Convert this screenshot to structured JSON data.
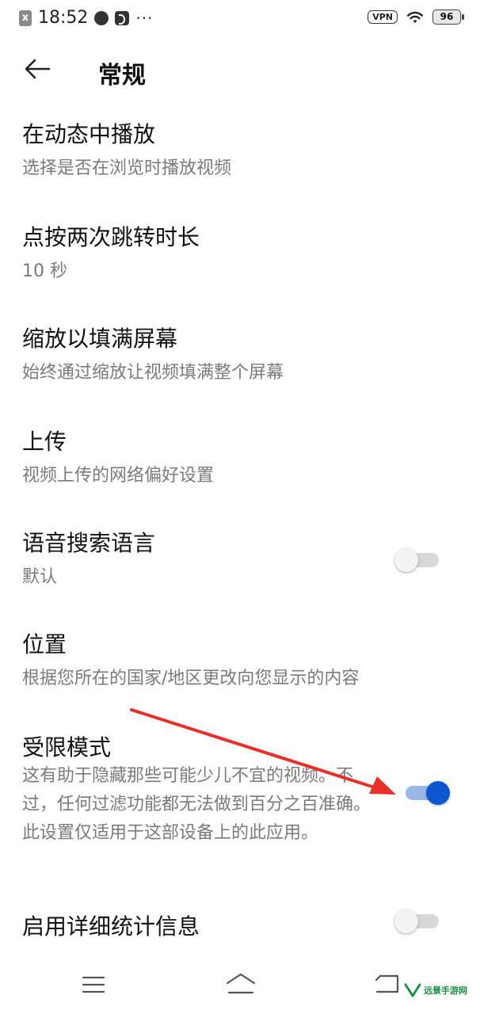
{
  "status_bar": {
    "time": "18:52",
    "more": "···",
    "vpn": "VPN",
    "battery": "96"
  },
  "header": {
    "title": "常规"
  },
  "settings": [
    {
      "title": "在动态中播放",
      "desc": "选择是否在浏览时播放视频"
    },
    {
      "title": "点按两次跳转时长",
      "desc": "10 秒"
    },
    {
      "title": "缩放以填满屏幕",
      "desc": "始终通过缩放让视频填满整个屏幕",
      "toggle": false
    },
    {
      "title": "上传",
      "desc": "视频上传的网络偏好设置"
    },
    {
      "title": "语音搜索语言",
      "desc": "默认"
    },
    {
      "title": "位置",
      "desc": "根据您所在的国家/地区更改向您显示的内容"
    },
    {
      "title": "受限模式",
      "desc": "这有助于隐藏那些可能少儿不宜的视频。不过，任何过滤功能都无法做到百分之百准确。此设置仅适用于这部设备上的此应用。",
      "toggle": true
    },
    {
      "title": "启用详细统计信息",
      "toggle": false
    }
  ],
  "colors": {
    "accent": "#0b57cf",
    "accent_track": "#9ab7ea",
    "annotation": "#e8302b"
  },
  "watermark": {
    "text": "远景手游网"
  }
}
